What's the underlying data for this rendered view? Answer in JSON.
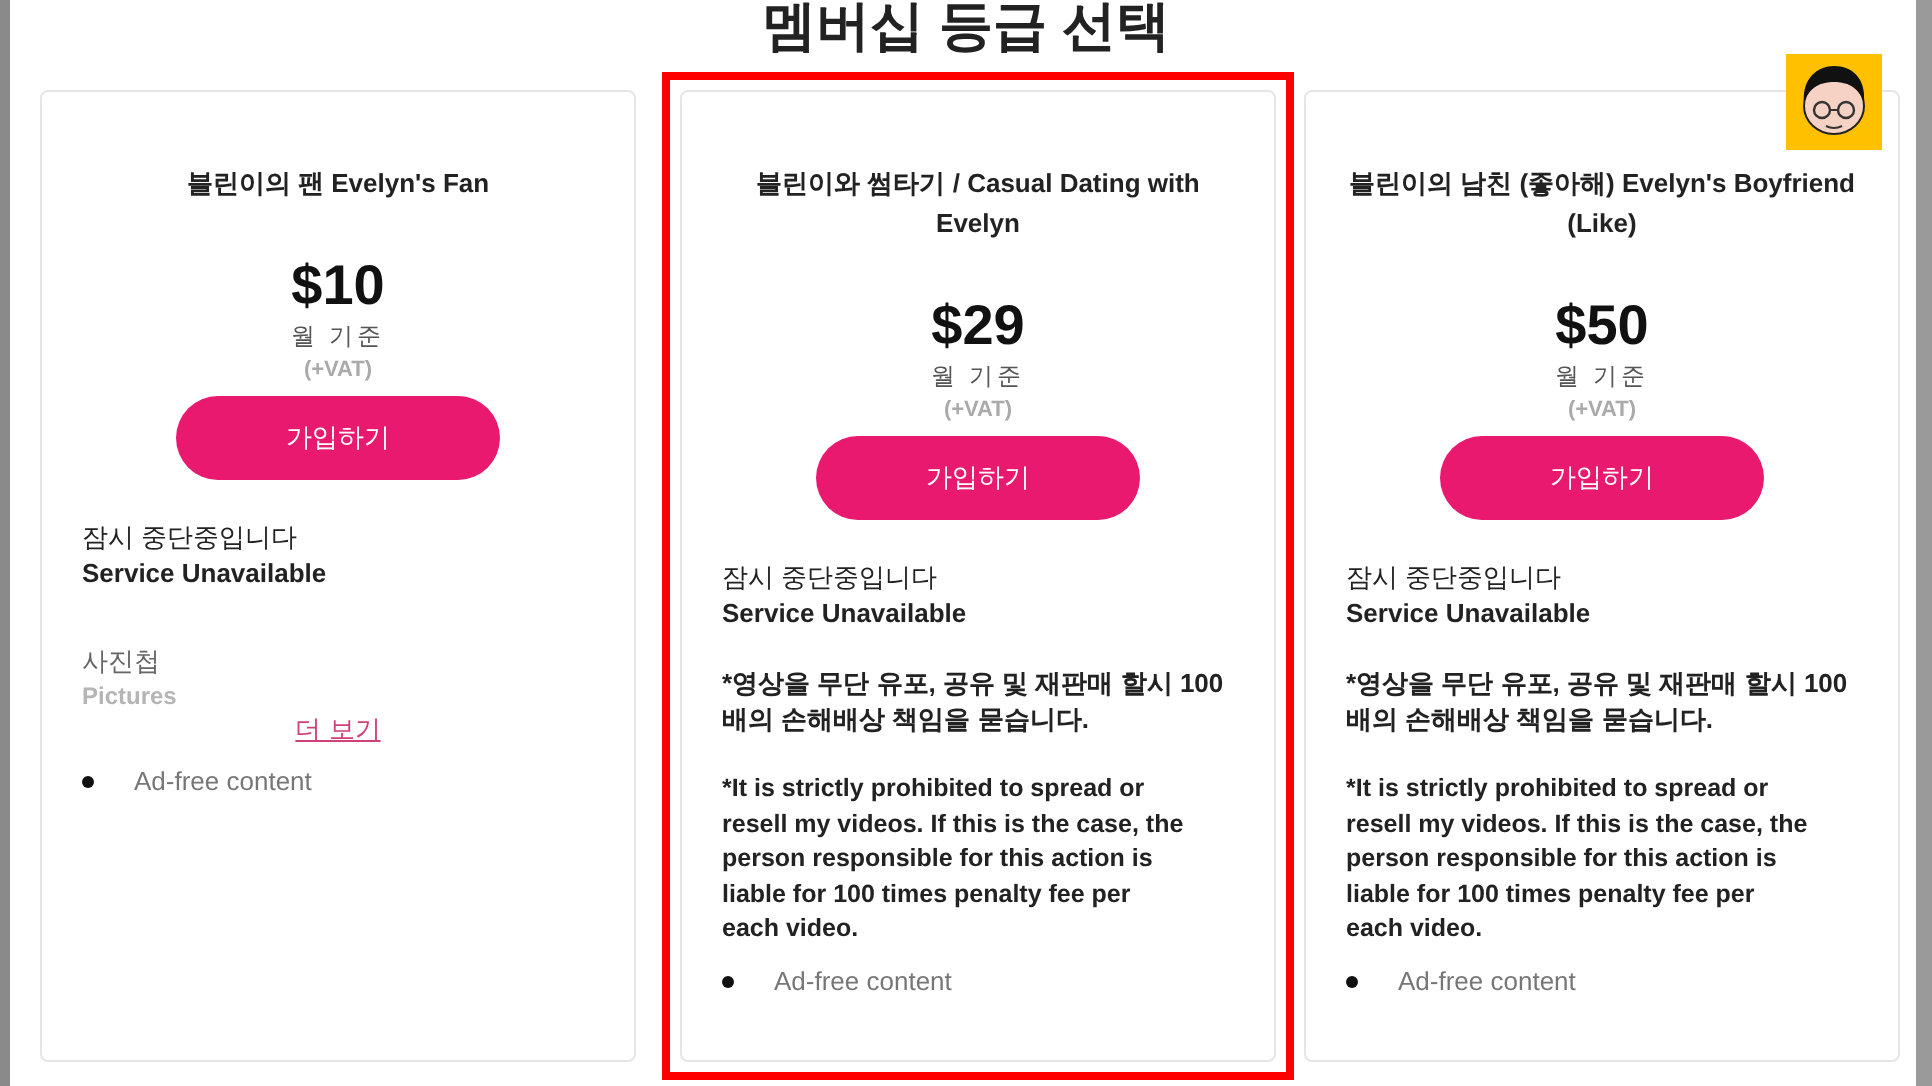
{
  "heading": "멤버십 등급 선택",
  "plans": [
    {
      "title": "블린이의 팬 Evelyn's Fan",
      "price": "$10",
      "period": "월 기준",
      "vat": "(+VAT)",
      "button": "가입하기",
      "status_ko": "잠시 중단중입니다",
      "status_en": "Service Unavailable",
      "highlighted": false,
      "gallery": {
        "title": "사진첩",
        "subtitle": "Pictures",
        "more": "더 보기"
      },
      "features": [
        "Ad-free content"
      ]
    },
    {
      "title": "블린이와 썸타기 / Casual Dating with Evelyn",
      "price": "$29",
      "period": "월 기준",
      "vat": "(+VAT)",
      "button": "가입하기",
      "status_ko": "잠시 중단중입니다",
      "status_en": "Service Unavailable",
      "highlighted": true,
      "notice_ko": "*영상을 무단 유포, 공유 및 재판매 할시 100배의 손해배상 책임을 묻습니다.",
      "notice_en": "*It is strictly prohibited to spread or resell my videos. If this is the case, the person responsible for this action is liable for 100 times penalty fee per each video.",
      "features": [
        "Ad-free content"
      ]
    },
    {
      "title": "블린이의 남친 (좋아해) Evelyn's Boyfriend (Like)",
      "price": "$50",
      "period": "월 기준",
      "vat": "(+VAT)",
      "button": "가입하기",
      "status_ko": "잠시 중단중입니다",
      "status_en": "Service Unavailable",
      "highlighted": false,
      "notice_ko": "*영상을 무단 유포, 공유 및 재판매 할시 100배의 손해배상 책임을 묻습니다.",
      "notice_en": "*It is strictly prohibited to spread or resell my videos. If this is the case, the person responsible for this action is liable for 100 times penalty fee per each video.",
      "features": [
        "Ad-free content"
      ]
    }
  ]
}
